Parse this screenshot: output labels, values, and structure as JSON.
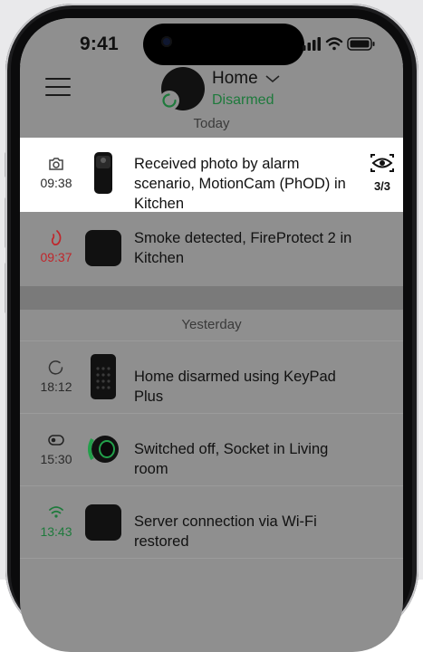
{
  "status_bar": {
    "time": "9:41"
  },
  "header": {
    "hub_name": "Home",
    "hub_state": "Disarmed",
    "accent": "#1e7a3c"
  },
  "sections": {
    "today": "Today",
    "yesterday": "Yesterday"
  },
  "events": [
    {
      "time": "09:38",
      "icon": "camera-icon",
      "text": "Received photo by alarm scenario, MotionCam (PhOD) in Kitchen",
      "action_icon": "eye-icon",
      "action_count": "3/3",
      "time_color": "#2a2a2a"
    },
    {
      "time": "09:37",
      "icon": "fire-icon",
      "text": "Smoke detected, FireProtect 2 in Kitchen",
      "time_color": "#c0262b"
    },
    {
      "time": "18:12",
      "icon": "disarm-icon",
      "text": "Home disarmed using KeyPad Plus",
      "time_color": "#2a2a2a"
    },
    {
      "time": "15:30",
      "icon": "toggle-off-icon",
      "text": "Switched off, Socket in Living room",
      "time_color": "#2a2a2a"
    },
    {
      "time": "13:43",
      "icon": "wifi-icon",
      "text": "Server connection via Wi-Fi restored",
      "time_color": "#1e7a3c"
    }
  ]
}
